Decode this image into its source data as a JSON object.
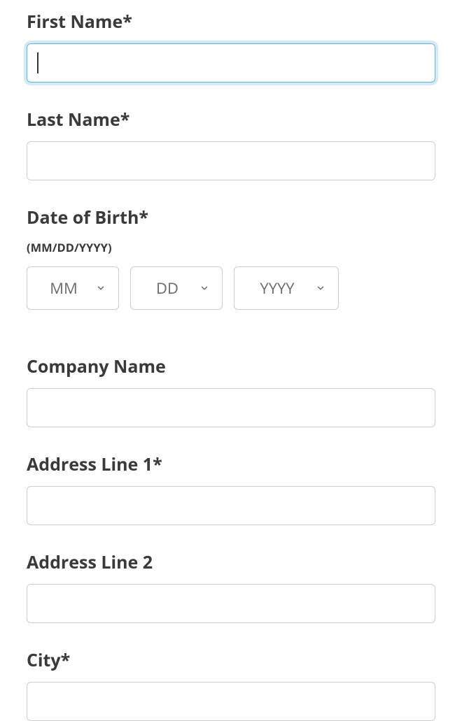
{
  "fields": {
    "first_name": {
      "label": "First Name*",
      "value": ""
    },
    "last_name": {
      "label": "Last Name*",
      "value": ""
    },
    "dob": {
      "label": "Date of Birth*",
      "hint": "(MM/DD/YYYY)",
      "month_placeholder": "MM",
      "day_placeholder": "DD",
      "year_placeholder": "YYYY"
    },
    "company": {
      "label": "Company Name",
      "value": ""
    },
    "address1": {
      "label": "Address Line 1*",
      "value": ""
    },
    "address2": {
      "label": "Address Line 2",
      "value": ""
    },
    "city": {
      "label": "City*",
      "value": ""
    }
  }
}
